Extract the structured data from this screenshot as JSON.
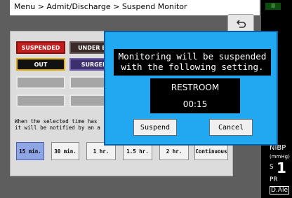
{
  "breadcrumb": "Menu > Admit/Discharge > Suspend Monitor",
  "back_icon": "return-arrow-icon",
  "modes": [
    "SUSPENDED",
    "UNDER EX",
    "OUT",
    "SURGER"
  ],
  "hint": "When the selected time has\nit will be notified by an a",
  "times": [
    "15 min.",
    "30 min.",
    "1 hr.",
    "1.5 hr.",
    "2 hr.",
    "Continuous"
  ],
  "selected_time": "15 min.",
  "right_panel": {
    "indicator": "II",
    "nibp": "NIBP",
    "nibp_unit": "(mmHg)",
    "s_label": "S",
    "s_value": "1",
    "pr_label": "PR",
    "alarm_label": "D.Ale"
  },
  "dialog": {
    "message_line1": "Monitoring will be suspended",
    "message_line2": "with the following setting.",
    "reason": "RESTROOM",
    "duration": "00:15",
    "suspend_label": "Suspend",
    "cancel_label": "Cancel"
  },
  "colors": {
    "dialog_bg": "#22a8f0",
    "selected_time_bg": "#8fa6e6",
    "suspended_red": "#c21c1c"
  }
}
